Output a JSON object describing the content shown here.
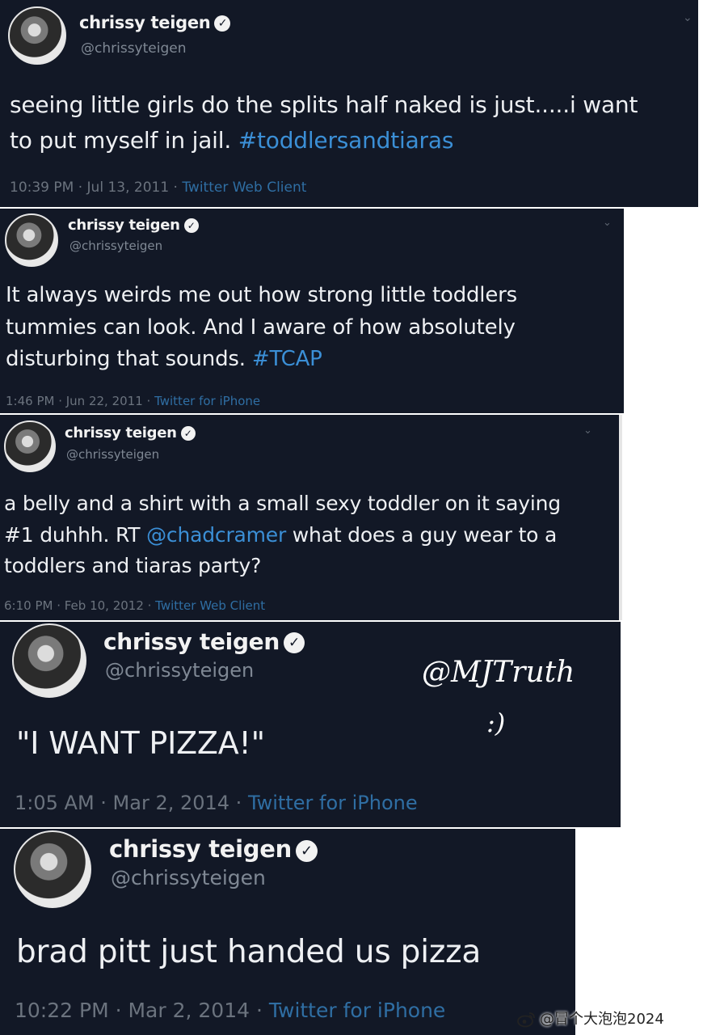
{
  "tweets": [
    {
      "name": "chrissy teigen",
      "handle": "@chrissyteigen",
      "lines": [
        {
          "text": "seeing little girls do the splits half naked is just.....i want",
          "tag": ""
        },
        {
          "text": "to put myself in jail. ",
          "tag": "#toddlersandtiaras"
        }
      ],
      "time": "10:39 PM · Jul 13, 2011 · ",
      "client": "Twitter Web Client"
    },
    {
      "name": "chrissy teigen",
      "handle": "@chrissyteigen",
      "lines": [
        {
          "text": "It always weirds me out how strong little toddlers",
          "tag": ""
        },
        {
          "text": "tummies can look. And I  aware of how absolutely",
          "tag": ""
        },
        {
          "text": "disturbing that sounds. ",
          "tag": "#TCAP"
        }
      ],
      "time": "1:46 PM · Jun 22, 2011 · ",
      "client": "Twitter for iPhone"
    },
    {
      "name": "chrissy teigen",
      "handle": "@chrissyteigen",
      "lines": [
        {
          "text": "a belly and a shirt with a small sexy toddler on it saying",
          "tag": "",
          "after": ""
        },
        {
          "text": "#1 duhhh. RT ",
          "tag": "@chadcramer",
          "after": "  what does a guy wear to a"
        },
        {
          "text": "toddlers and tiaras party?",
          "tag": "",
          "after": ""
        }
      ],
      "time": "6:10 PM · Feb 10, 2012 · ",
      "client": "Twitter Web Client"
    },
    {
      "name": "chrissy teigen",
      "handle": "@chrissyteigen",
      "text": "\"I WANT PIZZA!\"",
      "time": "1:05 AM · Mar 2, 2014 · ",
      "client": "Twitter for iPhone",
      "watermark": "@MJTruth",
      "smiley": ":)"
    },
    {
      "name": "chrissy teigen",
      "handle": "@chrissyteigen",
      "text": "brad pitt just handed us pizza",
      "time": "10:22 PM · Mar 2, 2014 · ",
      "client": "Twitter for iPhone"
    }
  ],
  "footer": {
    "text": "@冒个大泡泡2024",
    "icon": "weibo-icon"
  },
  "colors": {
    "card_bg": "#121826",
    "hashtag": "#3b8fd6",
    "client": "#2f6ea3"
  }
}
